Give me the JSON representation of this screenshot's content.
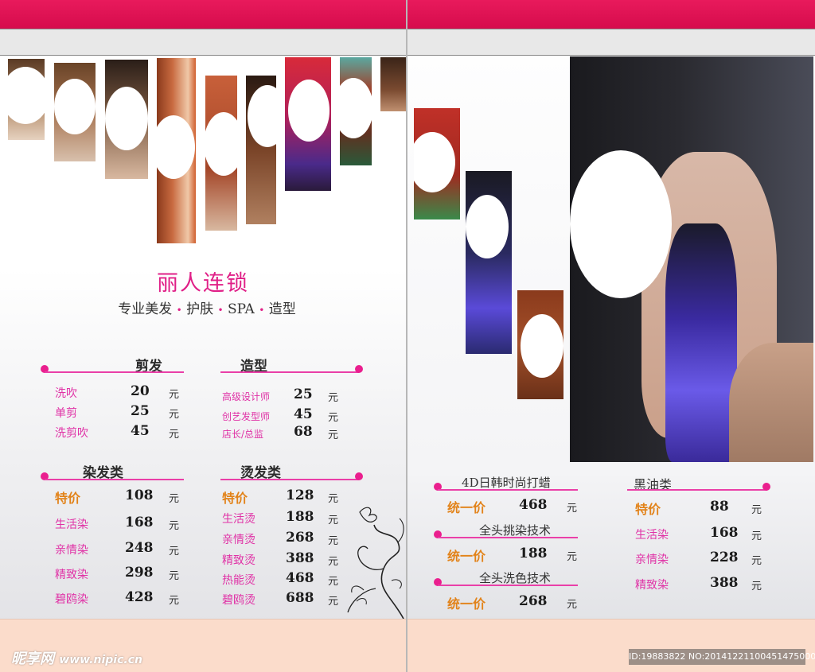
{
  "brand": {
    "title": "丽人连锁",
    "subtitle_parts": [
      "专业美发",
      "护肤",
      "SPA",
      "造型"
    ],
    "sep": "•"
  },
  "unit": "元",
  "menu_left": {
    "haircut": {
      "title": "剪发",
      "items": [
        {
          "name": "洗吹",
          "price": "20"
        },
        {
          "name": "单剪",
          "price": "25"
        },
        {
          "name": "洗剪吹",
          "price": "45"
        }
      ]
    },
    "styling": {
      "title": "造型",
      "items": [
        {
          "name": "高级设计师",
          "price": "25"
        },
        {
          "name": "创艺发型师",
          "price": "45"
        },
        {
          "name": "店长/总监",
          "price": "68"
        }
      ]
    },
    "dye": {
      "title": "染发类",
      "items": [
        {
          "name": "特价",
          "price": "108"
        },
        {
          "name": "生活染",
          "price": "168"
        },
        {
          "name": "亲情染",
          "price": "248"
        },
        {
          "name": "精致染",
          "price": "298"
        },
        {
          "name": "碧鸥染",
          "price": "428"
        }
      ]
    },
    "perm": {
      "title": "烫发类",
      "items": [
        {
          "name": "特价",
          "price": "128"
        },
        {
          "name": "生活烫",
          "price": "188"
        },
        {
          "name": "亲情烫",
          "price": "268"
        },
        {
          "name": "精致烫",
          "price": "388"
        },
        {
          "name": "热能烫",
          "price": "468"
        },
        {
          "name": "碧鸥烫",
          "price": "688"
        }
      ]
    }
  },
  "menu_right": {
    "wax": {
      "title": "4D日韩时尚打蜡",
      "label": "统一价",
      "price": "468"
    },
    "highlight": {
      "title": "全头挑染技术",
      "label": "统一价",
      "price": "188"
    },
    "wash_color": {
      "title": "全头洗色技术",
      "label": "统一价",
      "price": "268"
    },
    "black_oil": {
      "title": "黑油类",
      "items": [
        {
          "name": "特价",
          "price": "88"
        },
        {
          "name": "生活染",
          "price": "168"
        },
        {
          "name": "亲情染",
          "price": "228"
        },
        {
          "name": "精致染",
          "price": "388"
        }
      ]
    }
  },
  "watermark": {
    "logo": "昵享网",
    "site": "www.nipic.cn",
    "id_text": "ID:19883822 NO:20141221100451475000"
  },
  "colors": {
    "accent_pink": "#e01f87",
    "header_red": "#d60c4c",
    "special_orange": "#e2831a",
    "footer_peach": "#fbdccb"
  }
}
